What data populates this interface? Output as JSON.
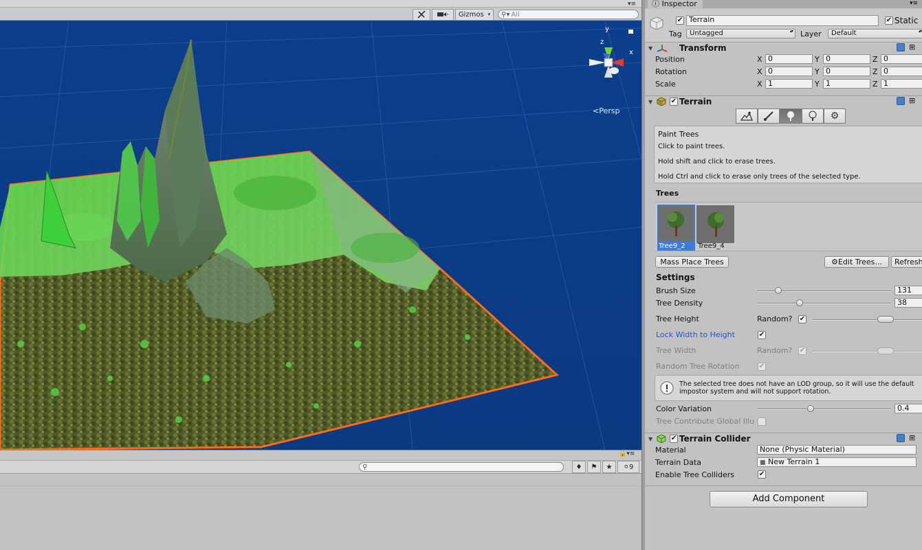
{
  "scene": {
    "toolbar": {
      "gizmos_label": "Gizmos",
      "search_placeholder": "All"
    },
    "persp_label": "<Persp",
    "axis_labels": {
      "y": "y",
      "x": "x",
      "z": "z"
    }
  },
  "bottom_panel": {
    "hidden_count": "9"
  },
  "inspector": {
    "tab_label": "Inspector",
    "object": {
      "name": "Terrain",
      "active": true,
      "static_label": "Static",
      "static": true,
      "tag_label": "Tag",
      "tag_value": "Untagged",
      "layer_label": "Layer",
      "layer_value": "Default"
    },
    "transform": {
      "title": "Transform",
      "rows": [
        {
          "label": "Position",
          "x": "0",
          "y": "0",
          "z": "0"
        },
        {
          "label": "Rotation",
          "x": "0",
          "y": "0",
          "z": "0"
        },
        {
          "label": "Scale",
          "x": "1",
          "y": "1",
          "z": "1"
        }
      ],
      "axis": {
        "x": "X",
        "y": "Y",
        "z": "Z"
      }
    },
    "terrain": {
      "title": "Terrain",
      "enabled": true,
      "tools": [
        "raise-lower-icon",
        "paint-texture-icon",
        "paint-trees-icon",
        "paint-details-icon",
        "settings-gear-icon"
      ],
      "active_tool": 2,
      "help": {
        "title": "Paint Trees",
        "line1": "Click to paint trees.",
        "line2": "Hold shift and click to erase trees.",
        "line3": "Hold Ctrl and click to erase only trees of the selected type."
      },
      "trees_heading": "Trees",
      "trees": [
        {
          "name": "Tree9_2",
          "selected": true
        },
        {
          "name": "Tree9_4",
          "selected": false
        }
      ],
      "mass_place_label": "Mass Place Trees",
      "edit_trees_label": "Edit Trees...",
      "refresh_label": "Refresh",
      "settings_heading": "Settings",
      "brush_size_label": "Brush Size",
      "brush_size_value": "131",
      "brush_size_fraction": 0.16,
      "tree_density_label": "Tree Density",
      "tree_density_value": "38",
      "tree_density_fraction": 0.32,
      "tree_height_label": "Tree Height",
      "random_label": "Random?",
      "lock_width_label": "Lock Width to Height",
      "tree_width_label": "Tree Width",
      "random_rotation_label": "Random Tree Rotation",
      "lod_warning_line1": "The selected tree does not have an LOD group, so it will use the default",
      "lod_warning_line2": "impostor system and will not support rotation.",
      "color_variation_label": "Color Variation",
      "color_variation_value": "0.4",
      "color_variation_fraction": 0.4,
      "global_illum_label": "Tree Contribute Global Illu"
    },
    "terrain_collider": {
      "title": "Terrain Collider",
      "enabled": true,
      "material_label": "Material",
      "material_value": "None (Physic Material)",
      "terrain_data_label": "Terrain Data",
      "terrain_data_value": "New Terrain 1",
      "tree_colliders_label": "Enable Tree Colliders",
      "tree_colliders": true
    },
    "add_component_label": "Add Component"
  }
}
